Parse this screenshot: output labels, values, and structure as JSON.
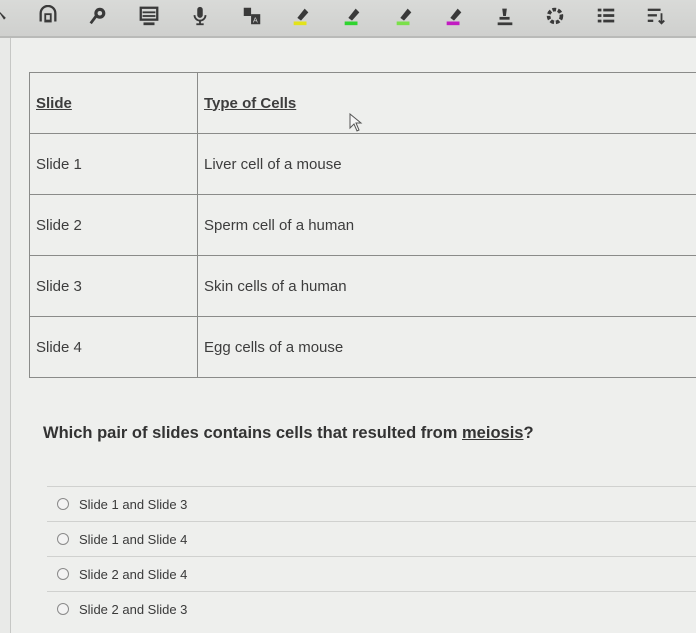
{
  "toolbar": {
    "icons": [
      {
        "name": "pointer-icon",
        "glyph": "↖"
      },
      {
        "name": "reader-icon",
        "glyph": ""
      },
      {
        "name": "text-to-speech-icon",
        "glyph": ""
      },
      {
        "name": "monitor-icon",
        "glyph": ""
      },
      {
        "name": "microphone-icon",
        "glyph": ""
      },
      {
        "name": "translate-icon",
        "glyph": ""
      },
      {
        "name": "highlighter-yellow-icon",
        "color": "#e3e31a"
      },
      {
        "name": "highlighter-green-icon",
        "color": "#2fd42f"
      },
      {
        "name": "highlighter-lightgreen-icon",
        "color": "#7be04a"
      },
      {
        "name": "highlighter-cyan-icon",
        "color": "#27c8c8"
      },
      {
        "name": "highlighter-magenta-icon",
        "color": "#c21cc2"
      },
      {
        "name": "eraser-icon",
        "glyph": ""
      },
      {
        "name": "settings-icon",
        "glyph": ""
      },
      {
        "name": "list-icon",
        "glyph": ""
      },
      {
        "name": "sort-icon",
        "glyph": ""
      }
    ]
  },
  "table": {
    "headers": [
      "Slide",
      "Type of Cells"
    ],
    "rows": [
      [
        "Slide 1",
        "Liver cell of a mouse"
      ],
      [
        "Slide 2",
        "Sperm cell of a human"
      ],
      [
        "Slide 3",
        "Skin cells of a human"
      ],
      [
        "Slide 4",
        "Egg cells of a mouse"
      ]
    ]
  },
  "question": {
    "prefix": "Which pair of slides contains cells that resulted from ",
    "underlined": "meiosis",
    "suffix": "?"
  },
  "options": [
    "Slide 1 and Slide 3",
    "Slide 1 and Slide 4",
    "Slide 2 and Slide 4",
    "Slide 2 and Slide 3"
  ]
}
